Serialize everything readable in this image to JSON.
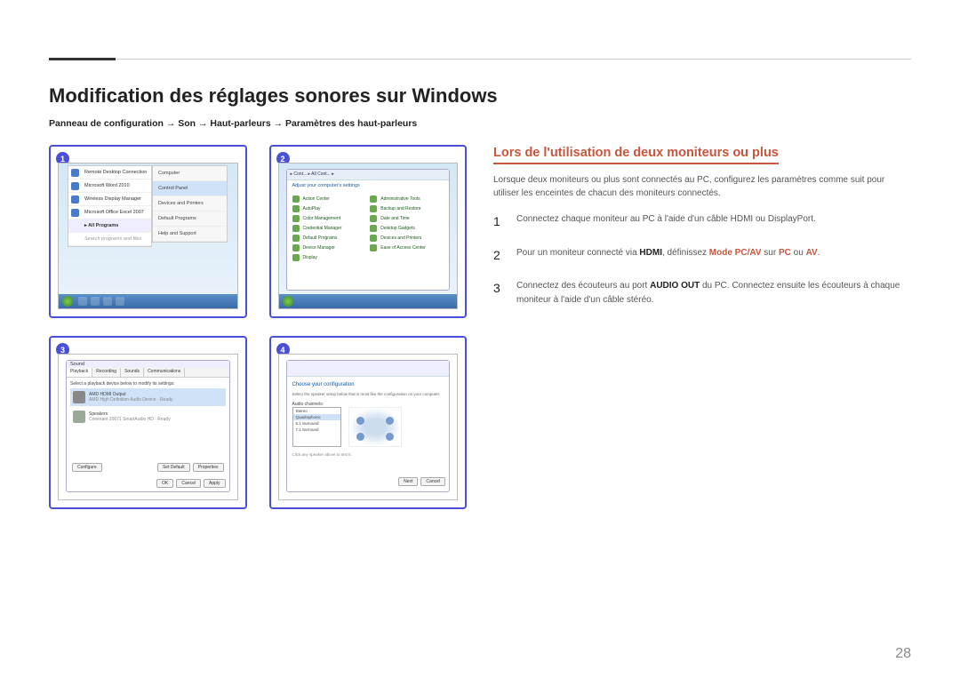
{
  "page_number": "28",
  "main_title": "Modification des réglages sonores sur Windows",
  "breadcrumb_parts": [
    "Panneau de configuration",
    "Son",
    "Haut-parleurs",
    "Paramètres des haut-parleurs"
  ],
  "breadcrumb_sep": " → ",
  "screenshots": {
    "s1": {
      "badge": "1",
      "menu_items": [
        "Remote Desktop Connection",
        "Microsoft Word 2010",
        "Wireless Display Manager",
        "Microsoft Office Excel 2007"
      ],
      "all_programs": "All Programs",
      "search_placeholder": "Search programs and files",
      "side_items": [
        "Computer",
        "Control Panel",
        "Devices and Printers",
        "Default Programs",
        "Help and Support"
      ]
    },
    "s2": {
      "badge": "2",
      "addr": "▸ Cont... ▸ All Cont... ▸",
      "header": "Adjust your computer's settings",
      "items_left": [
        "Action Center",
        "AutoPlay",
        "Color Management",
        "Credential Manager",
        "Default Programs",
        "Device Manager",
        "Display"
      ],
      "items_right": [
        "Administrative Tools",
        "Backup and Restore",
        "Date and Time",
        "Desktop Gadgets",
        "Devices and Printers",
        "Ease of Access Center"
      ]
    },
    "s3": {
      "badge": "3",
      "title": "Sound",
      "tabs": [
        "Playback",
        "Recording",
        "Sounds",
        "Communications"
      ],
      "hint": "Select a playback device below to modify its settings:",
      "dev1_name": "AMD HDMI Output",
      "dev1_sub": "AMD High Definition Audio Device · Ready",
      "dev2_name": "Speakers",
      "dev2_sub": "Conexant 20671 SmartAudio HD · Ready",
      "btn_configure": "Configure",
      "btn_default": "Set Default",
      "btn_properties": "Properties",
      "btn_ok": "OK",
      "btn_cancel": "Cancel",
      "btn_apply": "Apply"
    },
    "s4": {
      "badge": "4",
      "wizard_title": "Choose your configuration",
      "sub1": "Select the speaker setup below that is most like the configuration on your computer.",
      "label_channels": "Audio channels:",
      "options": [
        "Stereo",
        "Quadraphonic",
        "5.1 Surround",
        "7.1 Surround"
      ],
      "click_hint": "Click any speaker above to test it.",
      "btn_next": "Next",
      "btn_cancel": "Cancel"
    }
  },
  "right": {
    "heading": "Lors de l'utilisation de deux moniteurs ou plus",
    "intro": "Lorsque deux moniteurs ou plus sont connectés au PC, configurez les paramètres comme suit pour utiliser les enceintes de chacun des moniteurs connectés.",
    "steps": [
      {
        "num": "1",
        "text_before": "Connectez chaque moniteur au PC à l'aide d'un câble HDMI ou DisplayPort.",
        "highlights": []
      },
      {
        "num": "2",
        "text_before": "Pour un moniteur connecté via ",
        "highlights": [
          {
            "bold": "HDMI"
          },
          {
            "plain": ", définissez "
          },
          {
            "hl": "Mode PC/AV"
          },
          {
            "plain": " sur "
          },
          {
            "hl": "PC"
          },
          {
            "plain": " ou "
          },
          {
            "hl": "AV"
          },
          {
            "plain": "."
          }
        ]
      },
      {
        "num": "3",
        "text_before": "Connectez des écouteurs au port ",
        "highlights": [
          {
            "bold": "AUDIO OUT"
          },
          {
            "plain": " du PC. Connectez ensuite les écouteurs à chaque moniteur à l'aide d'un câble stéréo."
          }
        ]
      }
    ]
  }
}
